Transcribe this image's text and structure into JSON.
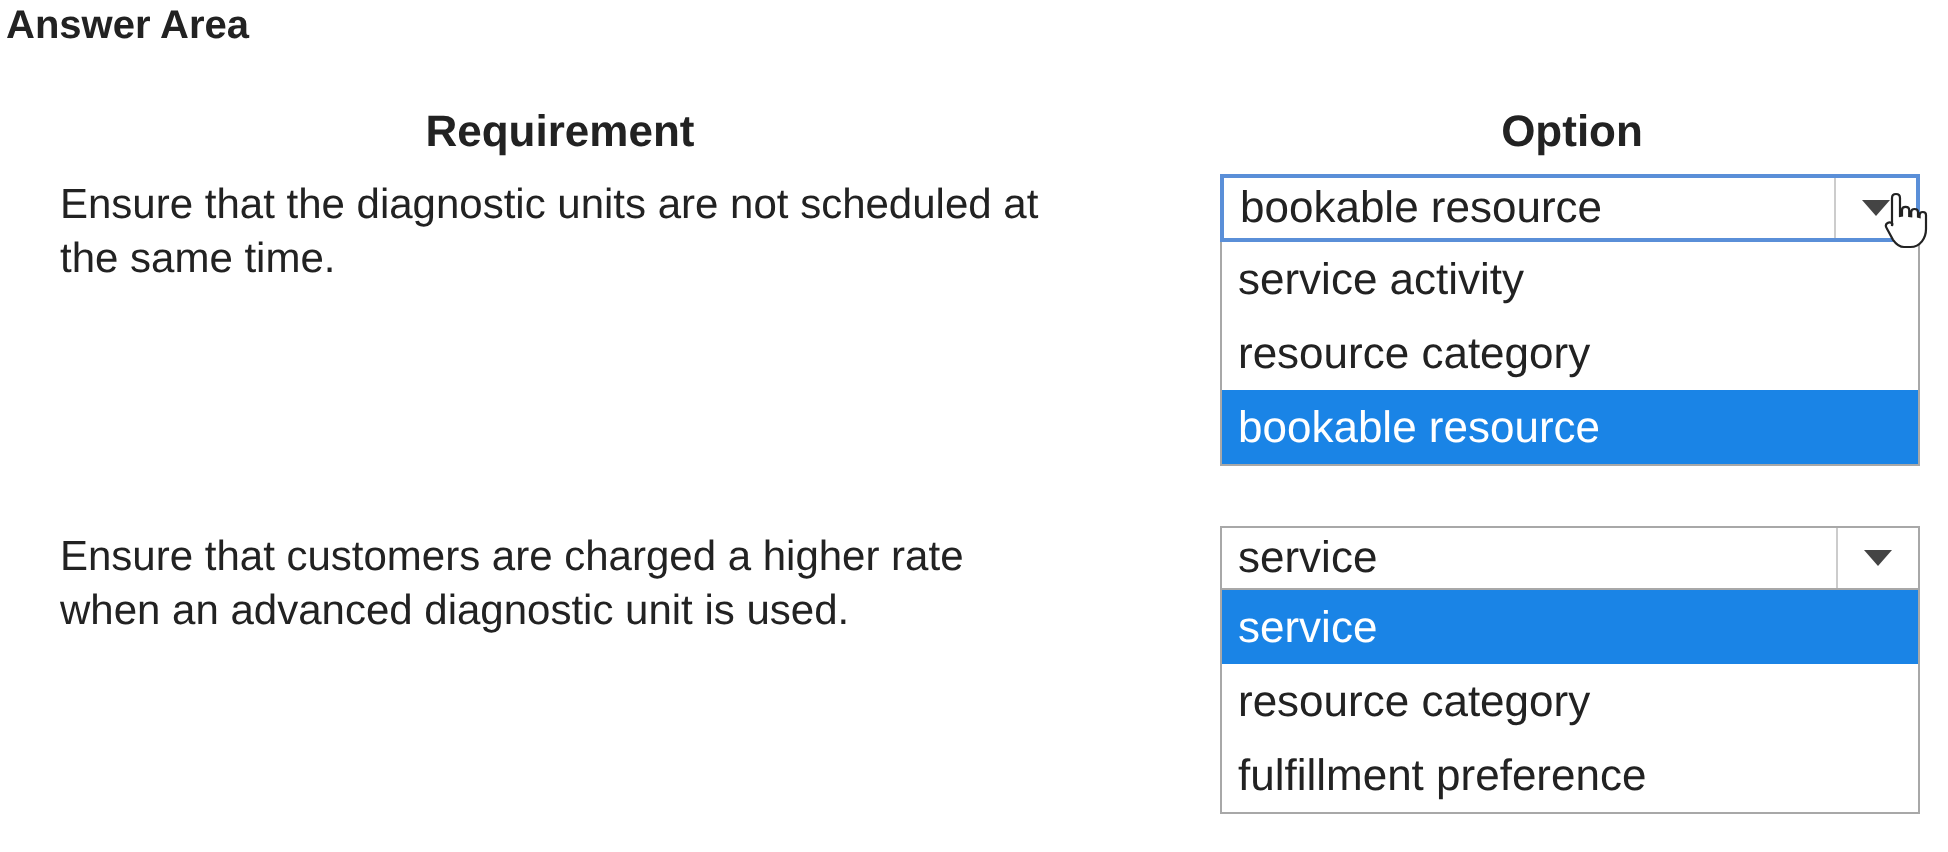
{
  "title": "Answer Area",
  "columns": [
    "Requirement",
    "Option"
  ],
  "rows": [
    {
      "requirement": "Ensure that the diagnostic units are not scheduled at the same time.",
      "dropdown": {
        "value": "bookable resource",
        "focused": true,
        "options": [
          {
            "label": "service activity",
            "selected": false
          },
          {
            "label": "resource category",
            "selected": false
          },
          {
            "label": "bookable resource",
            "selected": true
          }
        ]
      }
    },
    {
      "requirement": "Ensure that customers are charged a higher rate when an advanced diagnostic unit is used.",
      "dropdown": {
        "value": "service",
        "focused": false,
        "options": [
          {
            "label": "service",
            "selected": true
          },
          {
            "label": "resource category",
            "selected": false
          },
          {
            "label": "fulfillment preference",
            "selected": false
          }
        ]
      }
    }
  ]
}
